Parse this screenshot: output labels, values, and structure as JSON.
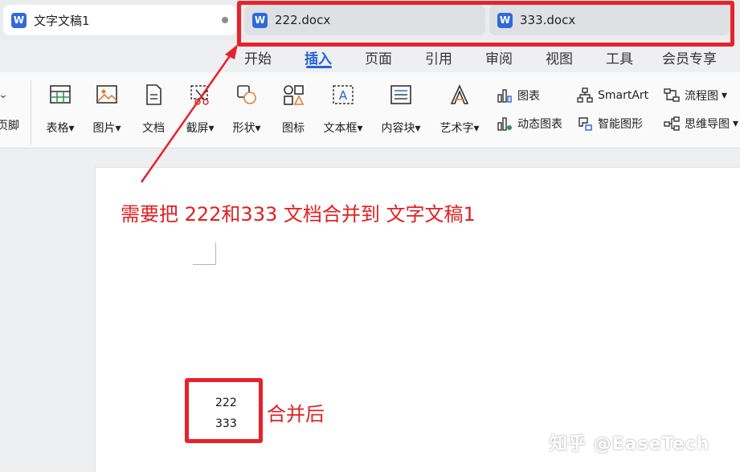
{
  "tabs": [
    {
      "label": "文字文稿1",
      "active": true
    },
    {
      "label": "222.docx",
      "active": false
    },
    {
      "label": "333.docx",
      "active": false
    }
  ],
  "menu": [
    "开始",
    "插入",
    "页面",
    "引用",
    "审阅",
    "视图",
    "工具",
    "会员专享"
  ],
  "menu_active": "插入",
  "ribbon": {
    "left_cut": "页脚",
    "buttons": [
      "表格",
      "图片",
      "文档",
      "截屏",
      "形状",
      "图标",
      "文本框",
      "内容块",
      "艺术字"
    ],
    "small": [
      "图表",
      "动态图表",
      "SmartArt",
      "智能图形",
      "流程图",
      "思维导图"
    ]
  },
  "annotation": {
    "instruction": "需要把 222和333 文档合并到 文字文稿1",
    "merged_label": "合并后",
    "merged_lines": [
      "222",
      "333"
    ]
  },
  "watermark": "知乎 @EaseTech",
  "colors": {
    "accent": "#2463d8",
    "annotation_red": "#e8222a",
    "word_blue": "#2f6bd8"
  }
}
